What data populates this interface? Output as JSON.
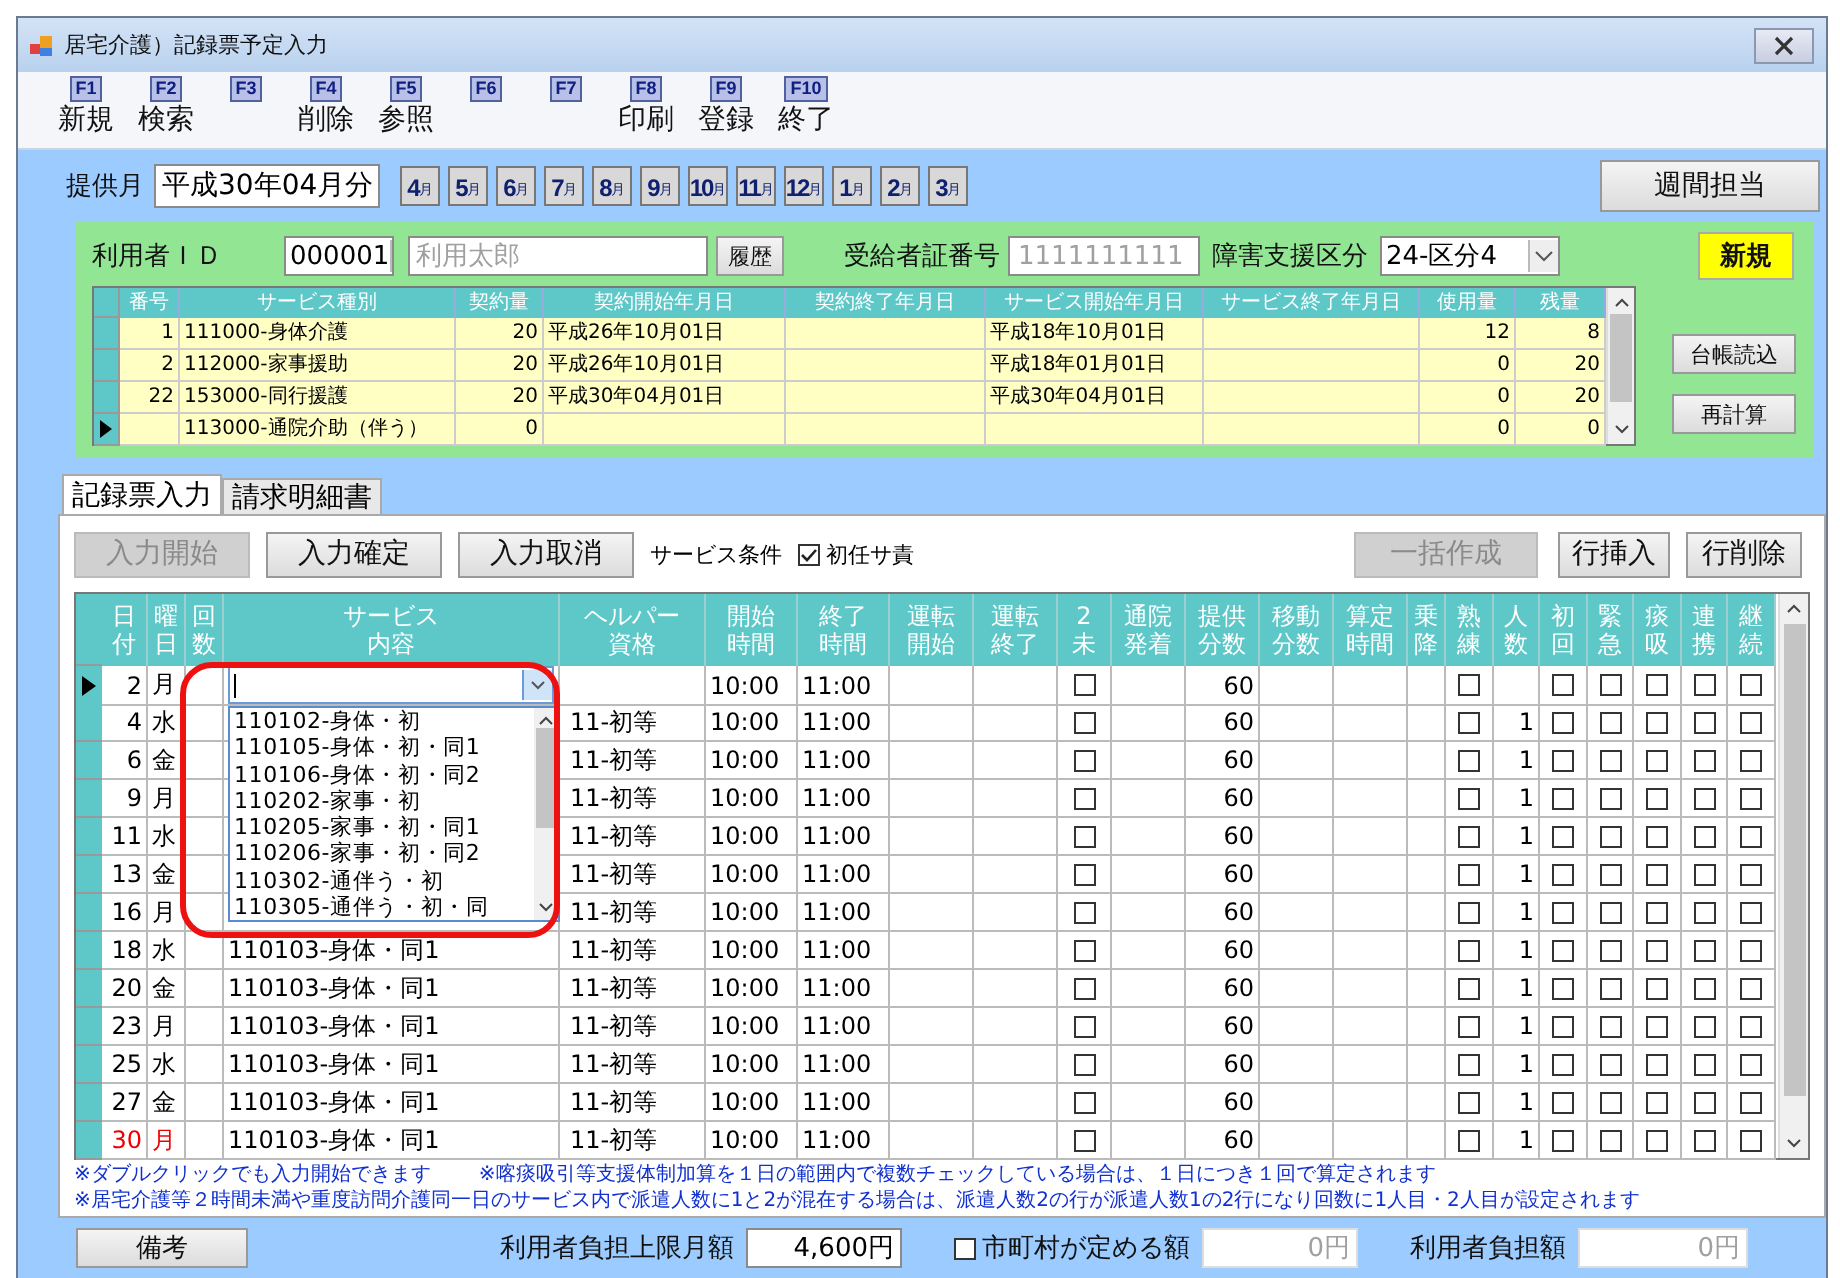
{
  "window": {
    "title": "居宅介護）記録票予定入力"
  },
  "toolbar": [
    {
      "key": "F1",
      "label": "新規"
    },
    {
      "key": "F2",
      "label": "検索"
    },
    {
      "key": "F3"
    },
    {
      "key": "F4",
      "label": "削除"
    },
    {
      "key": "F5",
      "label": "参照"
    },
    {
      "key": "F6"
    },
    {
      "key": "F7"
    },
    {
      "key": "F8",
      "label": "印刷"
    },
    {
      "key": "F9",
      "label": "登録"
    },
    {
      "key": "F10",
      "label": "終了"
    }
  ],
  "month": {
    "label": "提供月",
    "value": "平成30年04月分",
    "buttons": [
      {
        "number": "4",
        "unit": "月"
      },
      {
        "number": "5",
        "unit": "月"
      },
      {
        "number": "6",
        "unit": "月"
      },
      {
        "number": "7",
        "unit": "月"
      },
      {
        "number": "8",
        "unit": "月"
      },
      {
        "number": "9",
        "unit": "月"
      },
      {
        "number": "10",
        "unit": "月"
      },
      {
        "number": "11",
        "unit": "月"
      },
      {
        "number": "12",
        "unit": "月"
      },
      {
        "number": "1",
        "unit": "月"
      },
      {
        "number": "2",
        "unit": "月"
      },
      {
        "number": "3",
        "unit": "月"
      }
    ]
  },
  "weekly_button": "週間担当",
  "user": {
    "id_label": "利用者ＩＤ",
    "id_value": "000001",
    "name": "利用太郎",
    "history_button": "履歴",
    "cert_label": "受給者証番号",
    "cert_value": "1111111111",
    "class_label": "障害支援区分",
    "class_value": "24-区分4",
    "status_badge": "新規"
  },
  "contracts": {
    "columns": [
      "番号",
      "サービス種別",
      "契約量",
      "契約開始年月日",
      "契約終了年月日",
      "サービス開始年月日",
      "サービス終了年月日",
      "使用量",
      "残量"
    ],
    "rows": [
      {
        "cells": [
          "1",
          "111000-身体介護",
          "20",
          "平成26年10月01日",
          null,
          "平成18年10月01日",
          null,
          "12",
          "8"
        ],
        "current": false
      },
      {
        "cells": [
          "2",
          "112000-家事援助",
          "20",
          "平成26年10月01日",
          null,
          "平成18年01月01日",
          null,
          "0",
          "20"
        ],
        "current": false
      },
      {
        "cells": [
          "22",
          "153000-同行援護",
          "20",
          "平成30年04月01日",
          null,
          "平成30年04月01日",
          null,
          "0",
          "20"
        ],
        "current": false
      },
      {
        "cells": [
          null,
          "113000-通院介助（伴う）",
          "0",
          null,
          null,
          null,
          null,
          "0",
          "0"
        ],
        "current": true
      }
    ]
  },
  "side_buttons": [
    "台帳読込",
    "再計算"
  ],
  "tabs": [
    {
      "label": "記録票入力",
      "selected": true
    },
    {
      "label": "請求明細書",
      "selected": false
    }
  ],
  "actions": [
    {
      "label": "入力開始",
      "disabled": true
    },
    {
      "label": "入力確定",
      "disabled": false
    },
    {
      "label": "入力取消",
      "disabled": false
    }
  ],
  "service_condition": {
    "label": "サービス条件",
    "option": "初任サ責",
    "checked": true
  },
  "right_actions": [
    {
      "label": "一括作成",
      "disabled": true
    },
    {
      "label": "行挿入",
      "disabled": false
    },
    {
      "label": "行削除",
      "disabled": false
    }
  ],
  "schedule": {
    "columns": [
      {
        "label": [
          "日",
          "付"
        ],
        "kind": "text"
      },
      {
        "label": [
          "曜",
          "日"
        ],
        "kind": "text"
      },
      {
        "label": [
          "回",
          "数"
        ],
        "kind": "text"
      },
      {
        "label": [
          "サービス",
          "内容"
        ],
        "kind": "text"
      },
      {
        "label": [
          "ヘルパー",
          "資格"
        ],
        "kind": "text"
      },
      {
        "label": [
          "開始",
          "時間"
        ],
        "kind": "text"
      },
      {
        "label": [
          "終了",
          "時間"
        ],
        "kind": "text"
      },
      {
        "label": [
          "運転",
          "開始"
        ],
        "kind": "text"
      },
      {
        "label": [
          "運転",
          "終了"
        ],
        "kind": "text"
      },
      {
        "label": [
          "2",
          "未"
        ],
        "kind": "check"
      },
      {
        "label": [
          "通院",
          "発着"
        ],
        "kind": "text"
      },
      {
        "label": [
          "提供",
          "分数"
        ],
        "kind": "text"
      },
      {
        "label": [
          "移動",
          "分数"
        ],
        "kind": "text"
      },
      {
        "label": [
          "算定",
          "時間"
        ],
        "kind": "text"
      },
      {
        "label": [
          "乗",
          "降"
        ],
        "kind": "text"
      },
      {
        "label": [
          "熟",
          "練"
        ],
        "kind": "check"
      },
      {
        "label": [
          "人",
          "数"
        ],
        "kind": "text"
      },
      {
        "label": [
          "初",
          "回"
        ],
        "kind": "check"
      },
      {
        "label": [
          "緊",
          "急"
        ],
        "kind": "check"
      },
      {
        "label": [
          "痰",
          "吸"
        ],
        "kind": "check"
      },
      {
        "label": [
          "連",
          "携"
        ],
        "kind": "check"
      },
      {
        "label": [
          "継",
          "続"
        ],
        "kind": "check"
      }
    ],
    "rows": [
      {
        "holiday": false,
        "current": true,
        "cells": [
          "2",
          "月",
          null,
          null,
          null,
          "10:00",
          "11:00",
          null,
          null,
          false,
          null,
          "60",
          null,
          null,
          null,
          false,
          null,
          false,
          false,
          false,
          false,
          false
        ]
      },
      {
        "holiday": false,
        "current": false,
        "cells": [
          "4",
          "水",
          null,
          null,
          "11-初等",
          "10:00",
          "11:00",
          null,
          null,
          false,
          null,
          "60",
          null,
          null,
          null,
          false,
          "1",
          false,
          false,
          false,
          false,
          false
        ]
      },
      {
        "holiday": false,
        "current": false,
        "cells": [
          "6",
          "金",
          null,
          null,
          "11-初等",
          "10:00",
          "11:00",
          null,
          null,
          false,
          null,
          "60",
          null,
          null,
          null,
          false,
          "1",
          false,
          false,
          false,
          false,
          false
        ]
      },
      {
        "holiday": false,
        "current": false,
        "cells": [
          "9",
          "月",
          null,
          null,
          "11-初等",
          "10:00",
          "11:00",
          null,
          null,
          false,
          null,
          "60",
          null,
          null,
          null,
          false,
          "1",
          false,
          false,
          false,
          false,
          false
        ]
      },
      {
        "holiday": false,
        "current": false,
        "cells": [
          "11",
          "水",
          null,
          null,
          "11-初等",
          "10:00",
          "11:00",
          null,
          null,
          false,
          null,
          "60",
          null,
          null,
          null,
          false,
          "1",
          false,
          false,
          false,
          false,
          false
        ]
      },
      {
        "holiday": false,
        "current": false,
        "cells": [
          "13",
          "金",
          null,
          null,
          "11-初等",
          "10:00",
          "11:00",
          null,
          null,
          false,
          null,
          "60",
          null,
          null,
          null,
          false,
          "1",
          false,
          false,
          false,
          false,
          false
        ]
      },
      {
        "holiday": false,
        "current": false,
        "cells": [
          "16",
          "月",
          null,
          null,
          "11-初等",
          "10:00",
          "11:00",
          null,
          null,
          false,
          null,
          "60",
          null,
          null,
          null,
          false,
          "1",
          false,
          false,
          false,
          false,
          false
        ]
      },
      {
        "holiday": false,
        "current": false,
        "cells": [
          "18",
          "水",
          null,
          "110103-身体・同1",
          "11-初等",
          "10:00",
          "11:00",
          null,
          null,
          false,
          null,
          "60",
          null,
          null,
          null,
          false,
          "1",
          false,
          false,
          false,
          false,
          false
        ]
      },
      {
        "holiday": false,
        "current": false,
        "cells": [
          "20",
          "金",
          null,
          "110103-身体・同1",
          "11-初等",
          "10:00",
          "11:00",
          null,
          null,
          false,
          null,
          "60",
          null,
          null,
          null,
          false,
          "1",
          false,
          false,
          false,
          false,
          false
        ]
      },
      {
        "holiday": false,
        "current": false,
        "cells": [
          "23",
          "月",
          null,
          "110103-身体・同1",
          "11-初等",
          "10:00",
          "11:00",
          null,
          null,
          false,
          null,
          "60",
          null,
          null,
          null,
          false,
          "1",
          false,
          false,
          false,
          false,
          false
        ]
      },
      {
        "holiday": false,
        "current": false,
        "cells": [
          "25",
          "水",
          null,
          "110103-身体・同1",
          "11-初等",
          "10:00",
          "11:00",
          null,
          null,
          false,
          null,
          "60",
          null,
          null,
          null,
          false,
          "1",
          false,
          false,
          false,
          false,
          false
        ]
      },
      {
        "holiday": false,
        "current": false,
        "cells": [
          "27",
          "金",
          null,
          "110103-身体・同1",
          "11-初等",
          "10:00",
          "11:00",
          null,
          null,
          false,
          null,
          "60",
          null,
          null,
          null,
          false,
          "1",
          false,
          false,
          false,
          false,
          false
        ]
      },
      {
        "holiday": true,
        "current": false,
        "cells": [
          "30",
          "月",
          null,
          "110103-身体・同1",
          "11-初等",
          "10:00",
          "11:00",
          null,
          null,
          false,
          null,
          "60",
          null,
          null,
          null,
          false,
          "1",
          false,
          false,
          false,
          false,
          false
        ]
      }
    ],
    "dropdown": {
      "items": [
        "110102-身体・初",
        "110105-身体・初・同1",
        "110106-身体・初・同2",
        "110202-家事・初",
        "110205-家事・初・同1",
        "110206-家事・初・同2",
        "110302-通伴う・初",
        "110305-通伴う・初・同"
      ],
      "highlighted": true
    }
  },
  "notes": [
    [
      "※ダブルクリックでも入力開始できます",
      "※喀痰吸引等支援体制加算を１日の範囲内で複数チェックしている場合は、１日につき１回で算定されます"
    ],
    [
      "※居宅介護等２時間未満や重度訪問介護同一日のサービス内で派遣人数に1と2が混在する場合は、派遣人数2の行が派遣人数1の2行になり回数に1人目・2人目が設定されます"
    ]
  ],
  "footer": {
    "memo_button": "備考",
    "limit_label": "利用者負担上限月額",
    "limit_value": "4,600円",
    "municipal": {
      "label": "市町村が定める額",
      "checked": false
    },
    "municipal_value": "0円",
    "burden_label": "利用者負担額",
    "burden_value": "0円"
  }
}
